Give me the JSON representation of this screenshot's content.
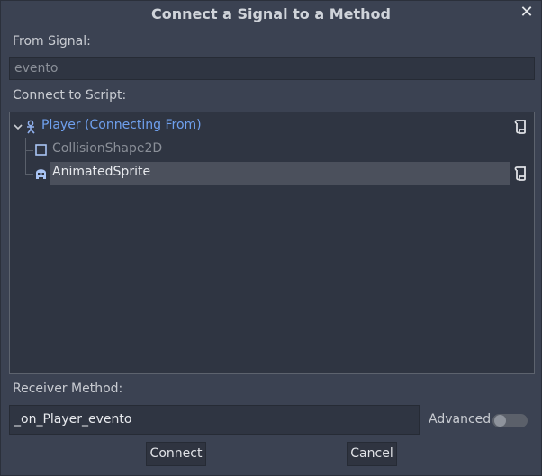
{
  "window": {
    "title": "Connect a Signal to a Method",
    "close_icon": "close-icon"
  },
  "from_signal": {
    "label": "From Signal:",
    "value": "evento"
  },
  "connect_to_script": {
    "label": "Connect to Script:"
  },
  "tree": {
    "items": [
      {
        "label": "Player (Connecting From)",
        "icon": "node2d-player-icon",
        "has_script": true,
        "color": "#6fa0ee"
      },
      {
        "label": "CollisionShape2D",
        "icon": "collision-shape-icon",
        "has_script": false,
        "color": "#8a8f98"
      },
      {
        "label": "AnimatedSprite",
        "icon": "animated-sprite-icon",
        "has_script": true,
        "color": "#e8eaee",
        "selected": true
      }
    ]
  },
  "receiver": {
    "label": "Receiver Method:",
    "value": "_on_Player_evento",
    "advanced_label": "Advanced",
    "advanced_on": false
  },
  "buttons": {
    "connect": "Connect",
    "cancel": "Cancel"
  },
  "colors": {
    "background": "#3b4252",
    "field_bg": "#2f3542",
    "accent": "#6fa0ee",
    "selection": "#4b505c"
  }
}
